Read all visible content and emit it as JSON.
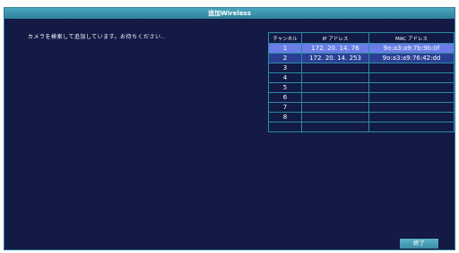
{
  "window": {
    "title": "追加Wireless"
  },
  "status_text": "カメラを検索して追加しています。お待ちください..",
  "table": {
    "headers": [
      "チャンネル",
      "IP アドレス",
      "MAC アドレス"
    ],
    "rows": [
      {
        "ch": "1",
        "ip": "172. 20. 14. 76",
        "mac": "9o:a3:a9:7b:9b:0f"
      },
      {
        "ch": "2",
        "ip": "172. 20. 14. 253",
        "mac": "9o:a3:a9:76:42:dd"
      },
      {
        "ch": "3",
        "ip": "",
        "mac": ""
      },
      {
        "ch": "4",
        "ip": "",
        "mac": ""
      },
      {
        "ch": "5",
        "ip": "",
        "mac": ""
      },
      {
        "ch": "6",
        "ip": "",
        "mac": ""
      },
      {
        "ch": "7",
        "ip": "",
        "mac": ""
      },
      {
        "ch": "8",
        "ip": "",
        "mac": ""
      },
      {
        "ch": "",
        "ip": "",
        "mac": ""
      }
    ]
  },
  "buttons": {
    "finish": "終了"
  }
}
